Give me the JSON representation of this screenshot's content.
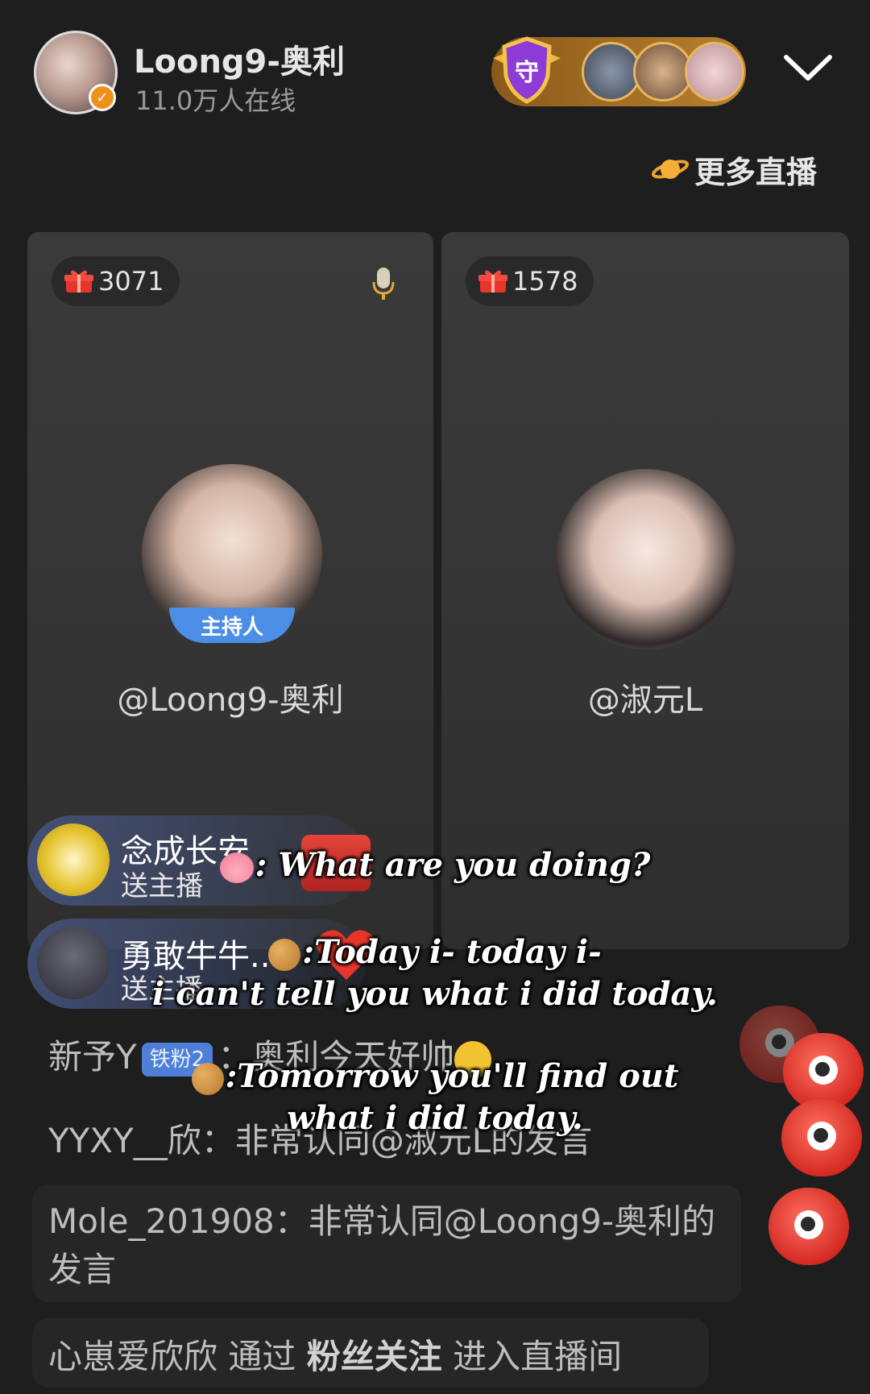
{
  "header": {
    "host_name": "Loong9-奥利",
    "online_count": "11.0万人在线",
    "guard_label": "守",
    "more_live": "更多直播"
  },
  "panels": {
    "left": {
      "gift_count": "3071",
      "host_tag": "主持人",
      "name": "@Loong9-奥利"
    },
    "right": {
      "gift_count": "1578",
      "name": "@淑元L"
    }
  },
  "gift_notices": [
    {
      "user": "念成长安",
      "action": "送主播"
    },
    {
      "user": "勇敢牛牛...",
      "action": "送主播"
    }
  ],
  "chat": [
    {
      "user": "新予Y",
      "badge": "铁粉2",
      "sep": "：",
      "text": "奥利今天好帅"
    },
    {
      "user": "YYXY__欣",
      "sep": "：",
      "text": "非常认同@淑元L的发言"
    },
    {
      "user": "Mole_201908",
      "sep": "：",
      "text": "非常认同@Loong9-奥利的发言"
    },
    {
      "part1": "心崽爱欣欣",
      "part2": "通过",
      "part3": "粉丝关注",
      "part4": "进入直播间"
    }
  ],
  "subtitles": {
    "line1": ": What are you doing?",
    "line2a": ":Today i- today i-",
    "line2b": "i can't tell you what i did today.",
    "line3a": ":Tomorrow you'll find out",
    "line3b": "what i did today."
  },
  "colors": {
    "background": "#1e1e1e",
    "panel": "#383838",
    "accent_red": "#e0322a",
    "badge_blue": "#4d7fd6",
    "verified_orange": "#f0901c"
  }
}
